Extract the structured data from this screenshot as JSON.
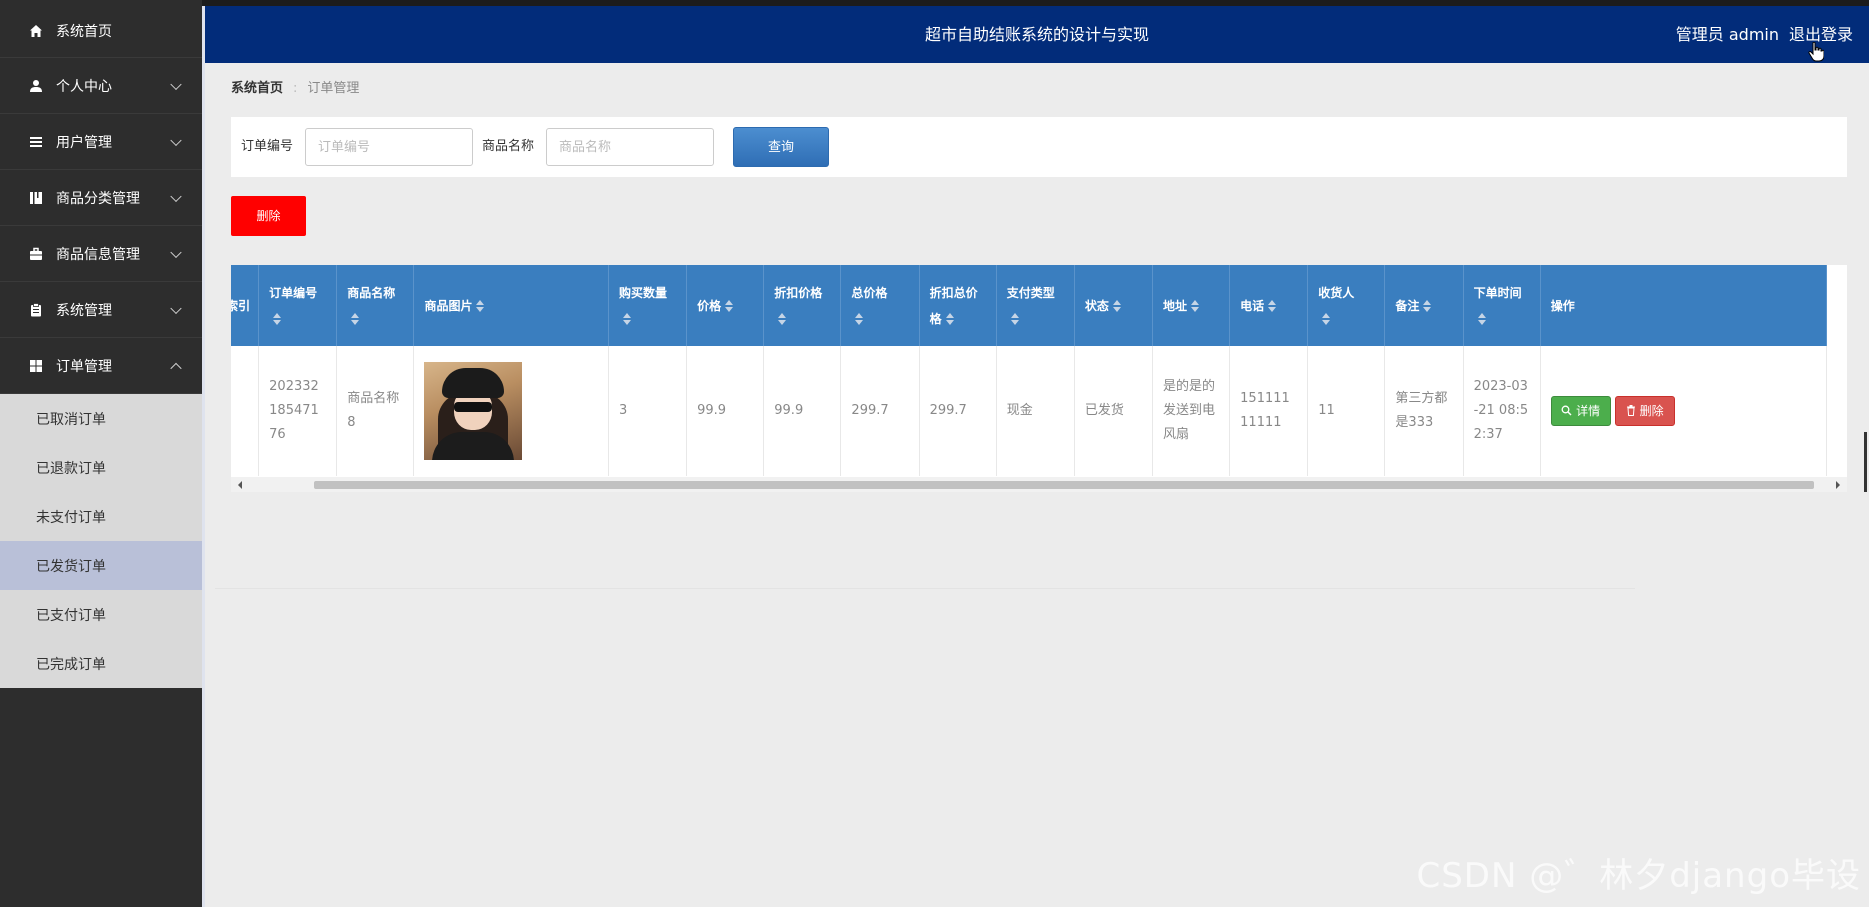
{
  "header": {
    "title": "超市自助结账系统的设计与实现",
    "admin_label": "管理员 admin",
    "logout_label": "退出登录"
  },
  "sidebar": {
    "items": [
      {
        "label": "系统首页",
        "icon": "home-icon",
        "expanded": false
      },
      {
        "label": "个人中心",
        "icon": "user-icon",
        "expanded": false
      },
      {
        "label": "用户管理",
        "icon": "list-icon",
        "expanded": false
      },
      {
        "label": "商品分类管理",
        "icon": "book-icon",
        "expanded": false
      },
      {
        "label": "商品信息管理",
        "icon": "briefcase-icon",
        "expanded": false
      },
      {
        "label": "系统管理",
        "icon": "clipboard-icon",
        "expanded": false
      },
      {
        "label": "订单管理",
        "icon": "grid-icon",
        "expanded": true
      }
    ],
    "submenu": [
      "已取消订单",
      "已退款订单",
      "未支付订单",
      "已发货订单",
      "已支付订单",
      "已完成订单"
    ],
    "active_submenu": "已发货订单"
  },
  "breadcrumb": {
    "home": "系统首页",
    "current": "订单管理"
  },
  "search": {
    "order_no_label": "订单编号",
    "order_no_placeholder": "订单编号",
    "order_no_value": "",
    "product_label": "商品名称",
    "product_placeholder": "商品名称",
    "product_value": "",
    "query_label": "查询"
  },
  "delete_label": "删除",
  "table": {
    "columns": [
      "索引",
      "订单编号",
      "商品名称",
      "商品图片",
      "购买数量",
      "价格",
      "折扣价格",
      "总价格",
      "折扣总价格",
      "支付类型",
      "状态",
      "地址",
      "电话",
      "收货人",
      "备注",
      "下单时间",
      "操作"
    ],
    "rows": [
      {
        "index": "",
        "order_no": "20233218547176",
        "product_name": "商品名称8",
        "quantity": "3",
        "price": "99.9",
        "discount_price": "99.9",
        "total_price": "299.7",
        "discount_total": "299.7",
        "pay_type": "现金",
        "status": "已发货",
        "address": "是的是的发送到电风扇",
        "phone": "15111111111",
        "receiver": "11",
        "remark": "第三方都是333",
        "order_time": "2023-03-21 08:52:37",
        "detail_label": "详情",
        "delete_label": "删除"
      }
    ]
  },
  "watermark": "CSDN @゛林夕django毕设",
  "colors": {
    "header_bg": "#022c7a",
    "sidebar_bg": "#2d2d2d",
    "table_header_bg": "#3a7ebf",
    "delete_red": "#ff0000",
    "detail_green": "#4cae4c"
  }
}
